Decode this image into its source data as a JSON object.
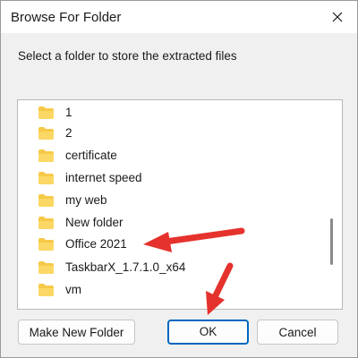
{
  "dialog": {
    "title": "Browse For Folder",
    "instruction": "Select a folder to store the extracted files"
  },
  "tree": {
    "items": [
      {
        "label": "1"
      },
      {
        "label": "2"
      },
      {
        "label": "certificate"
      },
      {
        "label": "internet speed"
      },
      {
        "label": "my web"
      },
      {
        "label": "New folder"
      },
      {
        "label": "Office 2021"
      },
      {
        "label": "TaskbarX_1.7.1.0_x64"
      },
      {
        "label": "vm"
      }
    ]
  },
  "buttons": {
    "make_new_folder": "Make New Folder",
    "ok": "OK",
    "cancel": "Cancel"
  },
  "icons": {
    "folder": "folder-icon",
    "close": "close-icon"
  },
  "colors": {
    "folder": "#f7c948",
    "accent": "#0067c0",
    "annotation_arrow": "#e5322d"
  }
}
